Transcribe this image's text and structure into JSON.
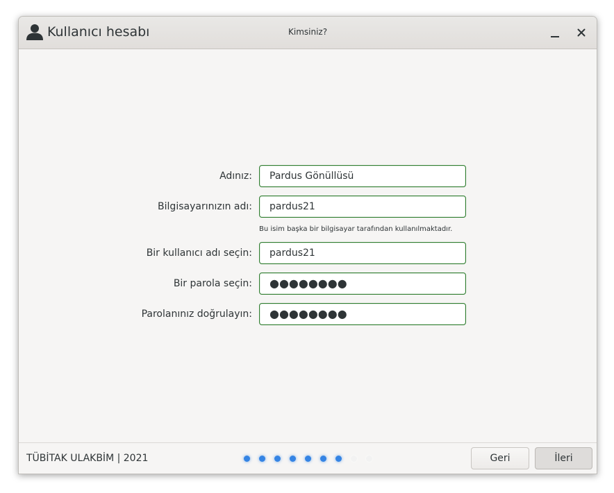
{
  "window": {
    "title": "Kullanıcı hesabı",
    "subtitle": "Kimsiniz?",
    "icons": {
      "title": "user-icon",
      "minimize": "minimize-icon",
      "close": "close-icon"
    }
  },
  "form": {
    "full_name": {
      "label": "Adınız:",
      "value": "Pardus Gönüllüsü"
    },
    "computer_name": {
      "label": "Bilgisayarınızın adı:",
      "value": "pardus21"
    },
    "computer_name_hint": "Bu isim başka bir bilgisayar tarafından kullanılmaktadır.",
    "username": {
      "label": "Bir kullanıcı adı seçin:",
      "value": "pardus21"
    },
    "password": {
      "label": "Bir parola seçin:",
      "value": "●●●●●●●●"
    },
    "password_confirm": {
      "label": "Parolanınız doğrulayın:",
      "value": "●●●●●●●●"
    }
  },
  "footer": {
    "credit": "TÜBİTAK ULAKBİM | 2021",
    "progress": {
      "total_steps": 9,
      "completed_steps": 7
    },
    "back_label": "Geri",
    "next_label": "İleri"
  },
  "colors": {
    "accent": "#3584e4",
    "input_border": "#2f7d2f",
    "background": "#f6f5f4"
  }
}
